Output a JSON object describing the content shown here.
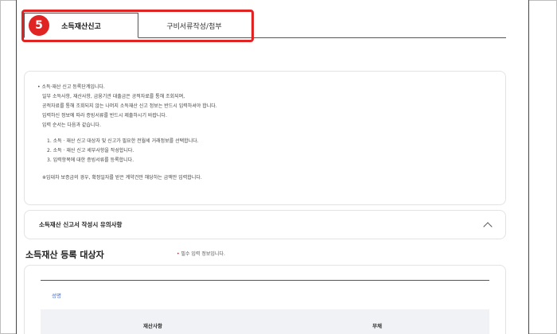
{
  "tabs": {
    "active_label": "소득재산신고",
    "inactive_label": "구비서류작성/첨부"
  },
  "step_badge": "5",
  "info": {
    "lines": [
      "• 소득·재산 신고 등록단계입니다.",
      "일부 소득사항, 재산사항, 금융기관 대출금은 공적자료를 통해 조회되며,",
      "공적자료를 통해 조회되지 않는 나머지 소득재산 신고 정보는 반드시 입력하셔야 합니다.",
      "입력하신 정보에 따라 증빙서류를 반드시 제출하시기 바랍니다.",
      "입력 순서는 다음과 같습니다."
    ],
    "steps": [
      "1. 소득 · 재산 신고 대상자 및 신고가 필요한 전월세 거래정보를 선택합니다.",
      "2. 소득 · 재산 신고 세부사항을 작성합니다.",
      "3. 입력항목에 대한 증빙서류를 등록합니다."
    ],
    "note": "※임대차 보증금의 경우, 확정일자를 받은 계약건만 해당하는 금액만 입력합니다."
  },
  "accordion": {
    "title": "소득재산 신고서 작성시 유의사항"
  },
  "section": {
    "title": "소득재산 등록 대상자",
    "required_mark": "•",
    "required_note": "필수 입력 정보입니다."
  },
  "card": {
    "field_label": "성명",
    "columns": [
      "재산사항",
      "부채"
    ]
  },
  "colors": {
    "highlight": "#e02424",
    "link_blue": "#3a6fd8"
  }
}
